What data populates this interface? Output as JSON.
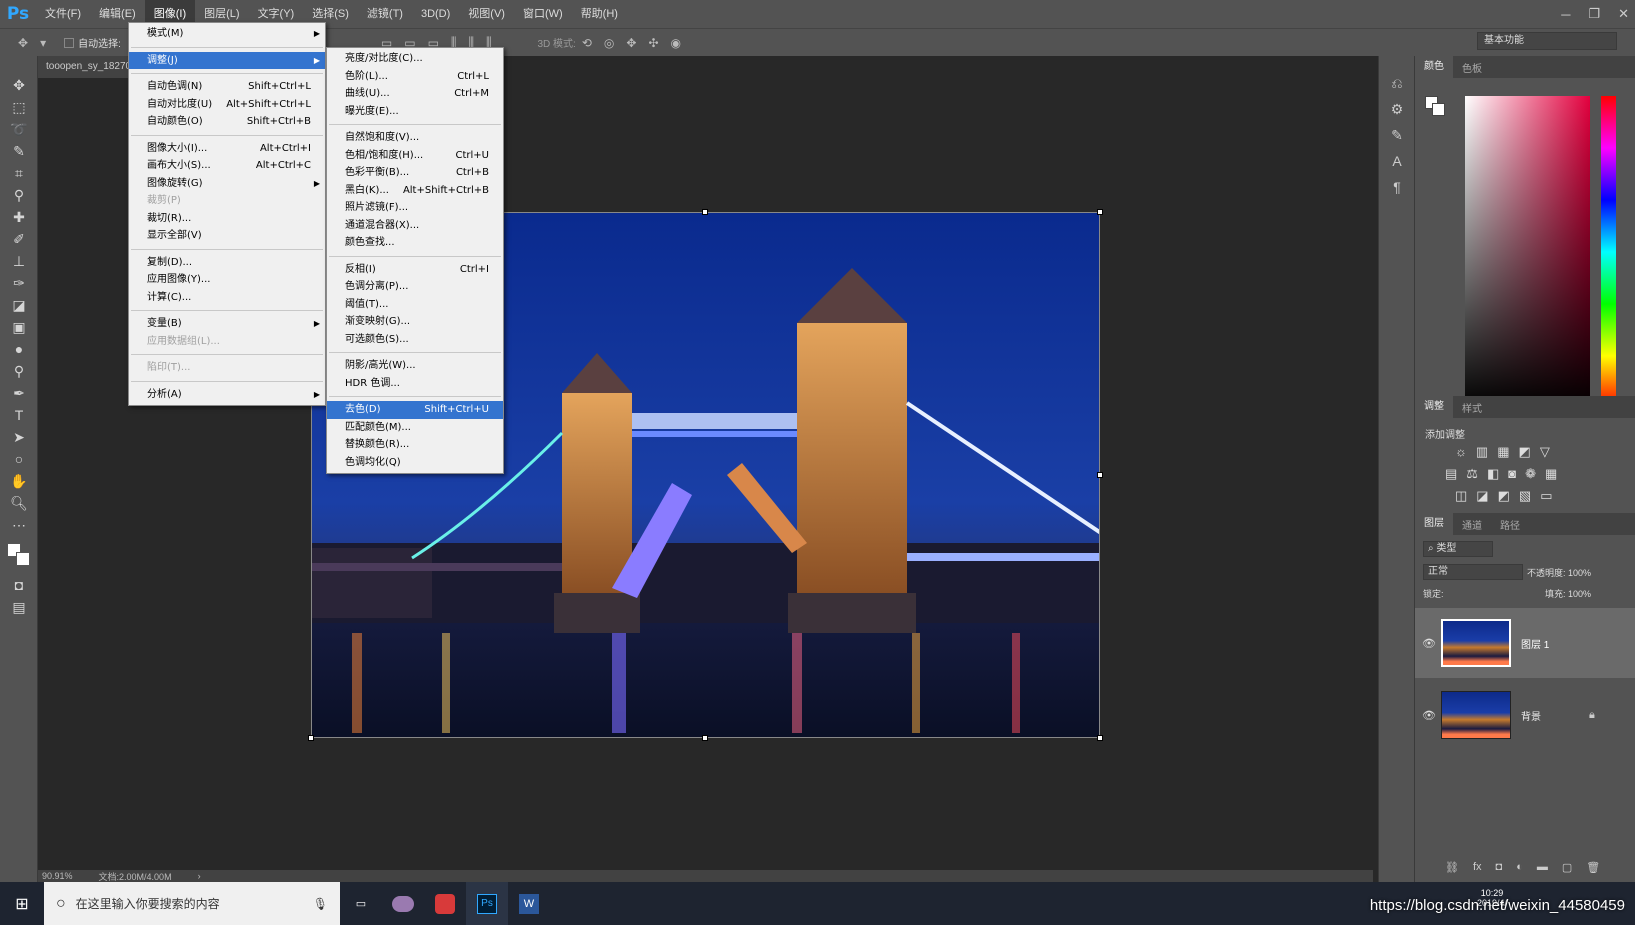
{
  "app": {
    "logo": "Ps"
  },
  "menubar": {
    "items": [
      "文件(F)",
      "编辑(E)",
      "图像(I)",
      "图层(L)",
      "文字(Y)",
      "选择(S)",
      "滤镜(T)",
      "3D(D)",
      "视图(V)",
      "窗口(W)",
      "帮助(H)"
    ],
    "active": 2
  },
  "window_controls": {
    "minimize": "─",
    "restore": "❐",
    "close": "✕"
  },
  "options_bar": {
    "auto_select_label": "自动选择:",
    "mode_3d": "3D 模式:",
    "workspace": "基本功能"
  },
  "document": {
    "tab_title": "tooopen_sy_18270",
    "zoom": "90.91%",
    "doc_size": "文档:2.00M/4.00M"
  },
  "image_menu": {
    "items": [
      {
        "label": "模式(M)",
        "shortcut": "",
        "submenu": true,
        "disabled": false
      },
      {
        "sep": true
      },
      {
        "label": "调整(J)",
        "shortcut": "",
        "submenu": true,
        "highlight": true
      },
      {
        "sep": true
      },
      {
        "label": "自动色调(N)",
        "shortcut": "Shift+Ctrl+L"
      },
      {
        "label": "自动对比度(U)",
        "shortcut": "Alt+Shift+Ctrl+L"
      },
      {
        "label": "自动颜色(O)",
        "shortcut": "Shift+Ctrl+B"
      },
      {
        "sep": true
      },
      {
        "label": "图像大小(I)...",
        "shortcut": "Alt+Ctrl+I"
      },
      {
        "label": "画布大小(S)...",
        "shortcut": "Alt+Ctrl+C"
      },
      {
        "label": "图像旋转(G)",
        "shortcut": "",
        "submenu": true
      },
      {
        "label": "裁剪(P)",
        "shortcut": "",
        "disabled": true
      },
      {
        "label": "裁切(R)...",
        "shortcut": ""
      },
      {
        "label": "显示全部(V)",
        "shortcut": ""
      },
      {
        "sep": true
      },
      {
        "label": "复制(D)...",
        "shortcut": ""
      },
      {
        "label": "应用图像(Y)...",
        "shortcut": ""
      },
      {
        "label": "计算(C)...",
        "shortcut": ""
      },
      {
        "sep": true
      },
      {
        "label": "变量(B)",
        "shortcut": "",
        "submenu": true
      },
      {
        "label": "应用数据组(L)...",
        "shortcut": "",
        "disabled": true
      },
      {
        "sep": true
      },
      {
        "label": "陷印(T)...",
        "shortcut": "",
        "disabled": true
      },
      {
        "sep": true
      },
      {
        "label": "分析(A)",
        "shortcut": "",
        "submenu": true
      }
    ]
  },
  "adjust_menu": {
    "items": [
      {
        "label": "亮度/对比度(C)...",
        "shortcut": ""
      },
      {
        "label": "色阶(L)...",
        "shortcut": "Ctrl+L"
      },
      {
        "label": "曲线(U)...",
        "shortcut": "Ctrl+M"
      },
      {
        "label": "曝光度(E)...",
        "shortcut": ""
      },
      {
        "sep": true
      },
      {
        "label": "自然饱和度(V)...",
        "shortcut": ""
      },
      {
        "label": "色相/饱和度(H)...",
        "shortcut": "Ctrl+U"
      },
      {
        "label": "色彩平衡(B)...",
        "shortcut": "Ctrl+B"
      },
      {
        "label": "黑白(K)...",
        "shortcut": "Alt+Shift+Ctrl+B"
      },
      {
        "label": "照片滤镜(F)...",
        "shortcut": ""
      },
      {
        "label": "通道混合器(X)...",
        "shortcut": ""
      },
      {
        "label": "颜色查找...",
        "shortcut": ""
      },
      {
        "sep": true
      },
      {
        "label": "反相(I)",
        "shortcut": "Ctrl+I"
      },
      {
        "label": "色调分离(P)...",
        "shortcut": ""
      },
      {
        "label": "阈值(T)...",
        "shortcut": ""
      },
      {
        "label": "渐变映射(G)...",
        "shortcut": ""
      },
      {
        "label": "可选颜色(S)...",
        "shortcut": ""
      },
      {
        "sep": true
      },
      {
        "label": "阴影/高光(W)...",
        "shortcut": ""
      },
      {
        "label": "HDR 色调...",
        "shortcut": ""
      },
      {
        "sep": true
      },
      {
        "label": "去色(D)",
        "shortcut": "Shift+Ctrl+U",
        "highlight": true
      },
      {
        "label": "匹配颜色(M)...",
        "shortcut": ""
      },
      {
        "label": "替换颜色(R)...",
        "shortcut": ""
      },
      {
        "label": "色调均化(Q)",
        "shortcut": ""
      }
    ]
  },
  "panels": {
    "color_tabs": [
      "颜色",
      "色板"
    ],
    "adjust_tabs": [
      "调整",
      "样式"
    ],
    "adjust_title": "添加调整",
    "layers_tabs": [
      "图层",
      "通道",
      "路径"
    ],
    "filter_kind": "类型",
    "blend_mode": "正常",
    "opacity_label": "不透明度:",
    "opacity_value": "100%",
    "lock_label": "锁定:",
    "fill_label": "填充:",
    "fill_value": "100%",
    "layers": [
      {
        "name": "图层 1"
      },
      {
        "name": "背景"
      }
    ]
  },
  "taskbar": {
    "search_placeholder": "在这里输入你要搜索的内容",
    "time": "10:29",
    "date": "2019/4/"
  },
  "watermark": "https://blog.csdn.net/weixin_44580459",
  "colors": {
    "menu_highlight": "#3474cf",
    "ui_bg": "#535353",
    "canvas_bg": "#282828",
    "ps_blue": "#31a8ff"
  }
}
